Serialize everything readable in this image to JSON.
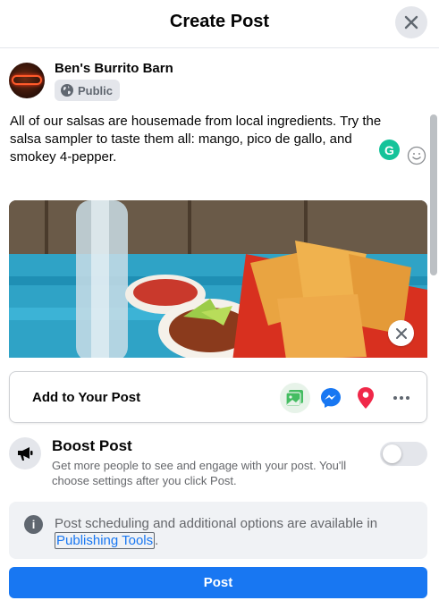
{
  "header": {
    "title": "Create Post",
    "close_icon": "close-icon"
  },
  "author": {
    "name": "Ben's Burrito Barn",
    "privacy_label": "Public",
    "privacy_icon": "globe-icon"
  },
  "composer": {
    "text": "All of our salsas are housemade from local ingredients. Try the salsa sampler to taste them all: mango, pico de gallo, and smokey 4-pepper.",
    "grammarly_letter": "G",
    "emoji_icon": "smiley-icon"
  },
  "add_to_post": {
    "label": "Add to Your Post",
    "icons": [
      "photo-video-icon",
      "messenger-icon",
      "location-pin-icon",
      "more-icon"
    ]
  },
  "boost": {
    "title": "Boost Post",
    "description": "Get more people to see and engage with your post. You'll choose settings after you click Post.",
    "enabled": false
  },
  "info": {
    "text": "Post scheduling and additional options are available in",
    "link": "Publishing Tools",
    "suffix": "."
  },
  "post_button": {
    "label": "Post"
  },
  "colors": {
    "accent": "#1877f2",
    "photo_green": "#45bd62",
    "location_red": "#f02849"
  }
}
